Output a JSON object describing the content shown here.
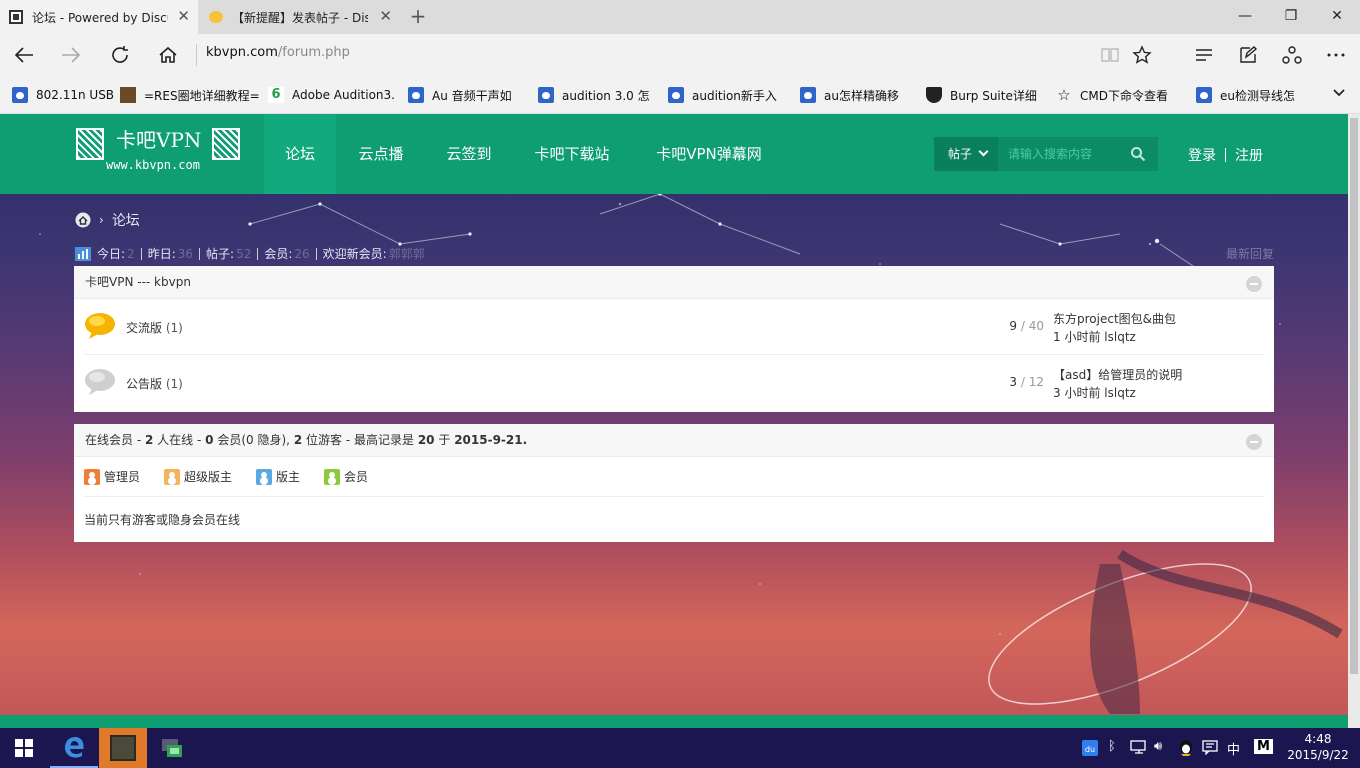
{
  "browser": {
    "tabs": [
      {
        "title": "论坛 - Powered by Discuz",
        "active": true
      },
      {
        "title": "【新提醒】发表帖子 - Discuz",
        "active": false
      }
    ],
    "address": {
      "host": "kbvpn.com",
      "path": "/forum.php"
    },
    "bookmarks": [
      "802.11n USB",
      "=RES圈地详细教程=",
      "Adobe Audition3.",
      "Au 音频干声如",
      "audition 3.0 怎",
      "audition新手入",
      "au怎样精确移",
      "Burp Suite详细",
      "CMD下命令查看",
      "eu检测导线怎"
    ]
  },
  "site": {
    "logo": {
      "title": "卡吧VPN",
      "subtitle": "www.kbvpn.com"
    },
    "nav": [
      "论坛",
      "云点播",
      "云签到",
      "卡吧下载站",
      "卡吧VPN弹幕网"
    ],
    "search": {
      "type": "帖子",
      "placeholder": "请输入搜索内容"
    },
    "login": "登录",
    "register": "注册",
    "breadcrumb": "论坛",
    "stats": {
      "today_label": "今日:",
      "today": "2",
      "yesterday_label": "昨日:",
      "yesterday": "36",
      "posts_label": "帖子:",
      "posts": "52",
      "members_label": "会员:",
      "members": "26",
      "newest_label": "欢迎新会员:",
      "newest": "郭郭郭"
    },
    "latest_replies": "最新回复",
    "category": {
      "title": "卡吧VPN --- kbvpn",
      "forums": [
        {
          "name": "交流版",
          "today": "(1)",
          "threads": "9",
          "posts": "40",
          "last_title": "东方project图包&曲包",
          "last_time": "1 小时前",
          "last_user": "lslqtz",
          "icon_color": "#f6b400"
        },
        {
          "name": "公告版",
          "today": "(1)",
          "threads": "3",
          "posts": "12",
          "last_title": "【asd】给管理员的说明",
          "last_time": "3 小时前",
          "last_user": "lslqtz",
          "icon_color": "#cfcfcf"
        }
      ]
    },
    "online": {
      "label": "在线会员",
      "total": "2",
      "total_label": "人在线",
      "members": "0",
      "members_label": "会员(0 隐身),",
      "guests": "2",
      "guests_label": "位游客",
      "record_label": "最高记录是",
      "record": "20",
      "record_on": "于",
      "record_date": "2015-9-21.",
      "legend": [
        {
          "label": "管理员",
          "color": "#f27c3a"
        },
        {
          "label": "超级版主",
          "color": "#f3b45b"
        },
        {
          "label": "版主",
          "color": "#5ba8e3"
        },
        {
          "label": "会员",
          "color": "#8ec83c"
        }
      ],
      "note": "当前只有游客或隐身会员在线"
    }
  },
  "taskbar": {
    "time": "4:48",
    "date": "2015/9/22",
    "ime": "中",
    "ime_mode": "M"
  }
}
